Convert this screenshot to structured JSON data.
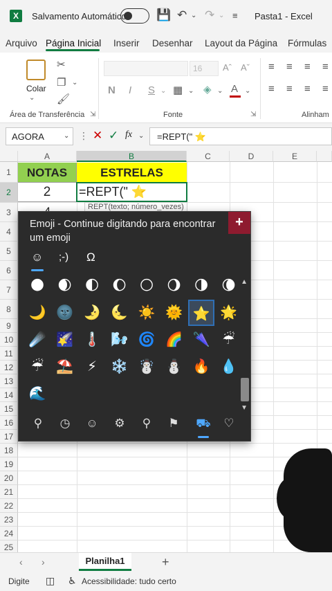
{
  "titlebar": {
    "autosave_label": "Salvamento Automático",
    "doc_title": "Pasta1  -  Excel",
    "icons": [
      "excel-logo",
      "save-icon",
      "undo-icon",
      "redo-icon",
      "customize-icon"
    ]
  },
  "tabs": [
    "Arquivo",
    "Página Inicial",
    "Inserir",
    "Desenhar",
    "Layout da Página",
    "Fórmulas"
  ],
  "ribbon": {
    "paste_label": "Colar",
    "clipboard_group": "Área de Transferência",
    "font_group": "Fonte",
    "align_group": "Alinham",
    "font_size": "16",
    "font_buttons": [
      "N",
      "I",
      "S"
    ]
  },
  "formula_bar": {
    "name_box": "AGORA",
    "fx": "fx",
    "formula": "=REPT(\" ⭐"
  },
  "grid": {
    "columns": [
      "A",
      "B",
      "C",
      "D",
      "E"
    ],
    "rows": [
      "1",
      "2",
      "3",
      "4",
      "5",
      "6",
      "7",
      "8",
      "9",
      "10",
      "11",
      "12",
      "13",
      "14",
      "15",
      "16",
      "17",
      "18",
      "19",
      "20",
      "21",
      "22",
      "23",
      "24",
      "25"
    ],
    "a1": "NOTAS",
    "b1": "ESTRELAS",
    "a2": "2",
    "b2": "=REPT(\" ⭐",
    "a3": "4",
    "tooltip": "REPT(texto; número_vezes)"
  },
  "emoji_panel": {
    "hint": "Emoji - Continue digitando para encontrar um emoji",
    "close_label": "+",
    "tabs": [
      "☺",
      ";-)",
      "Ω"
    ],
    "emojis": [
      [
        "🌑",
        "🌒",
        "🌓",
        "🌔",
        "🌕",
        "🌖",
        "🌗",
        "🌘"
      ],
      [
        "🌙",
        "🌚",
        "🌛",
        "🌜",
        "☀️",
        "🌞",
        "⭐",
        "🌟"
      ],
      [
        "☄️",
        "🌠",
        "🌡️",
        "🌬️",
        "🌀",
        "🌈",
        "🌂",
        "☔"
      ],
      [
        "☔",
        "⛱️",
        "⚡",
        "❄️",
        "☃️",
        "⛄",
        "🔥",
        "💧"
      ],
      [
        "🌊"
      ]
    ],
    "categories": [
      "search-icon",
      "recent-icon",
      "smiley-icon",
      "people-icon",
      "places-icon",
      "celebration-icon",
      "transport-icon",
      "heart-icon"
    ]
  },
  "sheets": {
    "active": "Planilha1",
    "add": "+"
  },
  "status": {
    "mode": "Digite",
    "accessibility": "Acessibilidade: tudo certo"
  },
  "colors": {
    "excel_green": "#107c41",
    "header_green": "#92d050",
    "header_yellow": "#ffff00",
    "emoji_bg": "#2b2b2b",
    "close_red": "#8e1b2f"
  }
}
